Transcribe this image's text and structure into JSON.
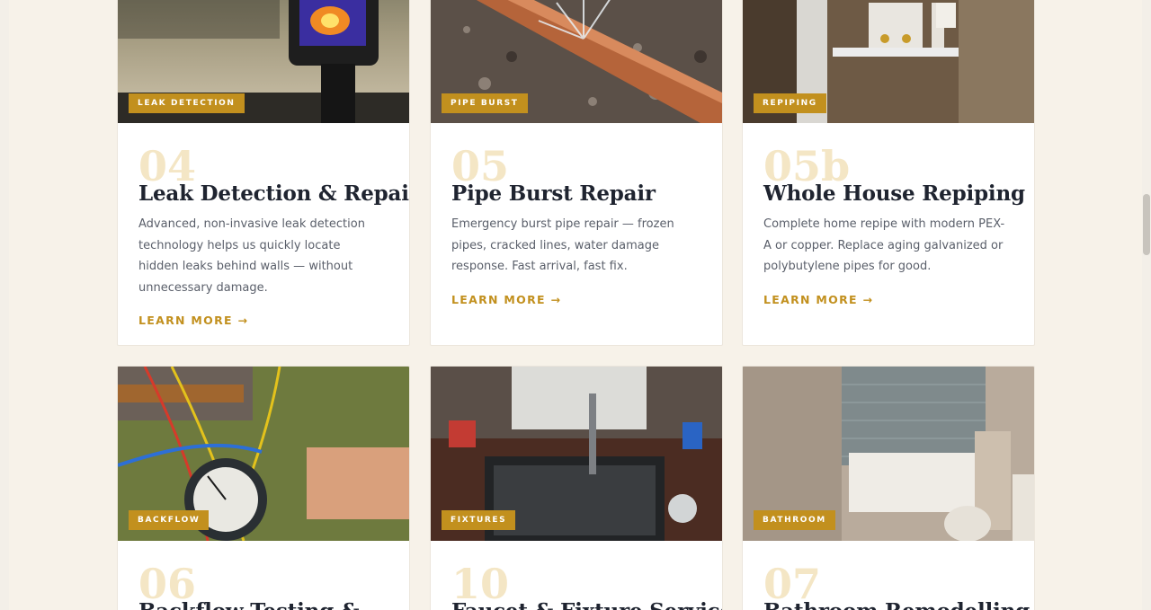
{
  "cards": [
    {
      "badge": "LEAK DETECTION",
      "number": "04",
      "title": "Leak Detection & Repair",
      "description": "Advanced, non-invasive leak detection technology helps us quickly locate hidden leaks behind walls — without unnecessary damage.",
      "link": "LEARN MORE →"
    },
    {
      "badge": "PIPE BURST",
      "number": "05",
      "title": "Pipe Burst Repair",
      "description": "Emergency burst pipe repair — frozen pipes, cracked lines, water damage response. Fast arrival, fast fix.",
      "link": "LEARN MORE →"
    },
    {
      "badge": "REPIPING",
      "number": "05b",
      "title": "Whole House Repiping",
      "description": "Complete home repipe with modern PEX-A or copper. Replace aging galvanized or polybutylene pipes for good.",
      "link": "LEARN MORE →"
    },
    {
      "badge": "BACKFLOW",
      "number": "06",
      "title": "Backflow Testing &"
    },
    {
      "badge": "FIXTURES",
      "number": "10",
      "title": "Faucet & Fixture Services"
    },
    {
      "badge": "BATHROOM",
      "number": "07",
      "title": "Bathroom Remodelling"
    }
  ],
  "colors": {
    "page_bg": "#f7f2e9",
    "accent": "#c2901e",
    "number_tint": "#f4e6c5",
    "title": "#1f2430",
    "body_text": "#5a5f6a"
  },
  "icons": {
    "link_arrow": "arrow-right-icon"
  }
}
